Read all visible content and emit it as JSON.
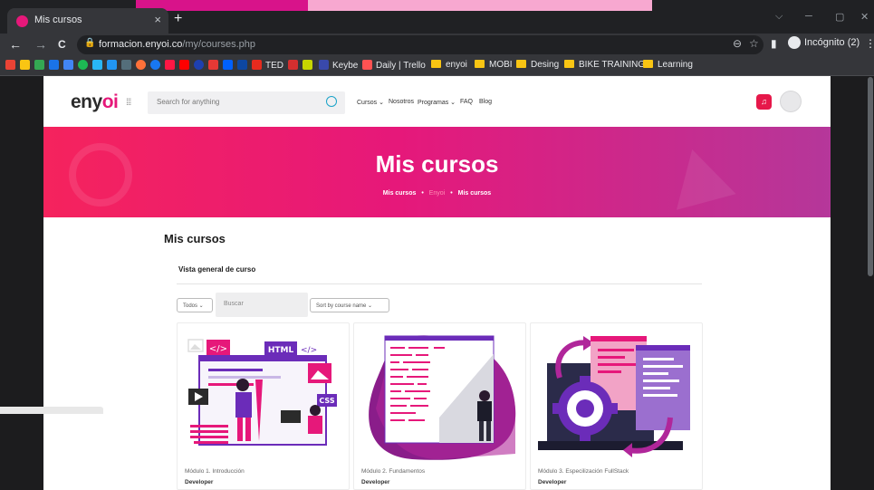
{
  "browser": {
    "tab_title": "Mis cursos",
    "tab_close": "×",
    "new_tab": "+",
    "url_host": "formacion.enyoi.co",
    "url_path": "/my/courses.php",
    "incognito": "Incógnito (2)",
    "controls": {
      "back": "←",
      "forward": "→",
      "reload": "C",
      "minimize": "─",
      "restore": "▢",
      "close": "✕",
      "dropdown": "⌵"
    },
    "bookmarks": [
      "TED",
      "Keybe",
      "Daily | Trello",
      "enyoi",
      "MOBI",
      "Desing",
      "BIKE TRAINING",
      "Learning"
    ]
  },
  "site": {
    "logo_prefix": "eny",
    "logo_accent": "oi",
    "search_placeholder": "Search for anything",
    "nav": [
      "Cursos ⌄",
      "Nosotros",
      "Programas ⌄",
      "FAQ",
      "Blog"
    ]
  },
  "hero": {
    "title": "Mis cursos",
    "breadcrumb": [
      "Mis cursos",
      "Enyoi",
      "Mis cursos"
    ],
    "separator": "•"
  },
  "main": {
    "title": "Mis cursos",
    "block_title": "Vista general de curso",
    "filter_label": "Todos ⌄",
    "search_placeholder": "Buscar",
    "sort_label": "Sort by course name ⌄"
  },
  "courses": [
    {
      "name": "Módulo 1. Introducción",
      "category": "Developer"
    },
    {
      "name": "Módulo 2. Fundamentos",
      "category": "Developer"
    },
    {
      "name": "Módulo 3. Especilización FullStack",
      "category": "Developer"
    }
  ],
  "illustration_text": {
    "html": "HTML",
    "css": "CSS",
    "code_open": "</>",
    "code_open_alt": "</>"
  },
  "colors": {
    "accent": "#e6187a",
    "hero_start": "#f5235d",
    "hero_end": "#b5379a",
    "purple": "#6b2cb9",
    "bell": "#e6184a"
  }
}
